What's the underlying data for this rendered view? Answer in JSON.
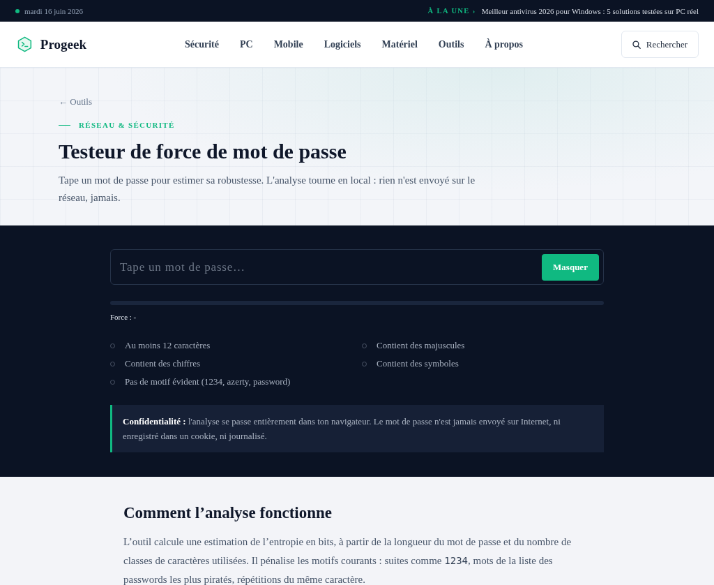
{
  "top_bar": {
    "date": "mardi 16 juin 2026",
    "headline_label": "À LA UNE ›",
    "headline": "Meilleur antivirus 2026 pour Windows : 5 solutions testées sur PC réel"
  },
  "header": {
    "brand": "Progeek",
    "nav": [
      "Sécurité",
      "PC",
      "Mobile",
      "Logiciels",
      "Matériel",
      "Outils",
      "À propos"
    ],
    "search_button": "Rechercher"
  },
  "hero": {
    "back_link": "← Outils",
    "kicker": "RÉSEAU & SÉCURITÉ",
    "title": "Testeur de force de mot de passe",
    "intro": "Tape un mot de passe pour estimer sa robustesse. L'analyse tourne en local : rien n'est envoyé sur le réseau, jamais."
  },
  "tool": {
    "password_field": {
      "placeholder": "Tape un mot de passe…"
    },
    "toggle_button": "Masquer",
    "strength": {
      "label": "Force : -"
    },
    "criteria": [
      {
        "label": "Au moins 12 caractères",
        "met": false
      },
      {
        "label": "Contient des majuscules",
        "met": false
      },
      {
        "label": "Contient des chiffres",
        "met": false
      },
      {
        "label": "Contient des symboles",
        "met": false
      },
      {
        "label": "Pas de motif évident (1234, azerty, password)",
        "met": false
      }
    ],
    "privacy_note": "**Confidentialité :** l'analyse se passe entièrement dans ton navigateur. Le mot de passe n'est jamais envoyé sur Internet, ni enregistré dans un cookie, ni journalisé."
  },
  "article": {
    "heading": "Comment l’analyse fonctionne",
    "paragraph": [
      {
        "kind": "text",
        "text": "L’outil calcule une estimation de l’entropie en bits, à partir de la longueur du mot de passe et du nombre de classes de caractères utilisées. Il pénalise les motifs courants : suites comme "
      },
      {
        "kind": "code",
        "text": "1234"
      },
      {
        "kind": "text",
        "text": ", mots de la liste des passwords les plus piratés, répétitions du même caractère."
      }
    ]
  }
}
